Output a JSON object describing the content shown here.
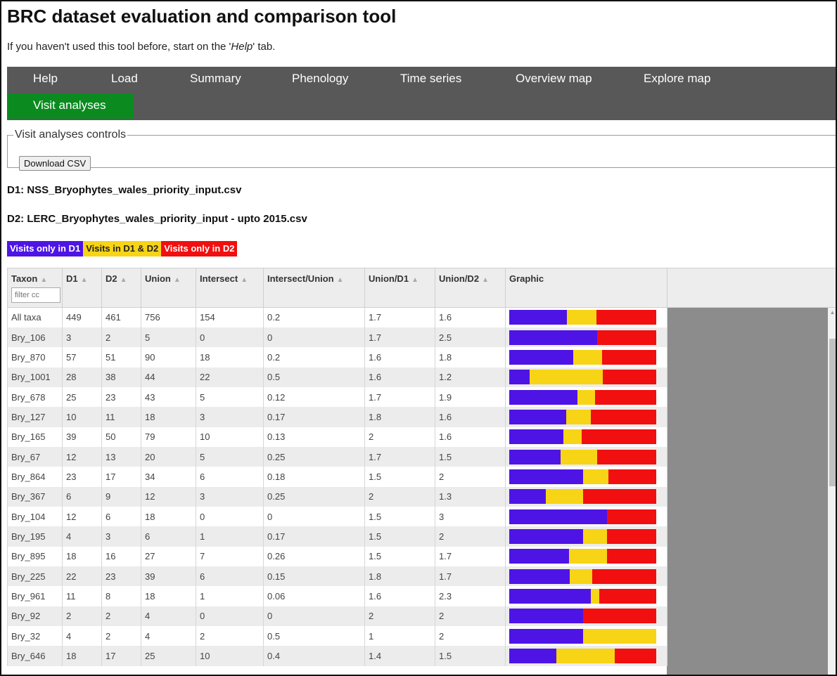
{
  "title": "BRC dataset evaluation and comparison tool",
  "intro": {
    "before": "If you haven't used this tool before, start on the '",
    "emph": "Help",
    "after": "' tab."
  },
  "nav": {
    "tabs": [
      "Help",
      "Load",
      "Summary",
      "Phenology",
      "Time series",
      "Overview map",
      "Explore map"
    ],
    "active_tab": "Visit analyses"
  },
  "controls": {
    "legend": "Visit analyses controls",
    "download_label": "Download CSV"
  },
  "datasets": {
    "d1": "D1: NSS_Bryophytes_wales_priority_input.csv",
    "d2": "D2: LERC_Bryophytes_wales_priority_input - upto 2015.csv"
  },
  "legend": {
    "only_d1": "Visits only in D1",
    "both": "Visits in D1 & D2",
    "only_d2": "Visits only in D2"
  },
  "colors": {
    "only_d1": "#4e14e6",
    "both": "#f7d415",
    "only_d2": "#f20f0f",
    "nav_bg": "#585858",
    "active_tab": "#0a8a1f"
  },
  "table": {
    "columns": [
      "Taxon",
      "D1",
      "D2",
      "Union",
      "Intersect",
      "Intersect/Union",
      "Union/D1",
      "Union/D2",
      "Graphic"
    ],
    "filter_placeholder": "filter cc",
    "rows": [
      [
        "All taxa",
        "449",
        "461",
        "756",
        "154",
        "0.2",
        "1.7",
        "1.6"
      ],
      [
        "Bry_106",
        "3",
        "2",
        "5",
        "0",
        "0",
        "1.7",
        "2.5"
      ],
      [
        "Bry_870",
        "57",
        "51",
        "90",
        "18",
        "0.2",
        "1.6",
        "1.8"
      ],
      [
        "Bry_1001",
        "28",
        "38",
        "44",
        "22",
        "0.5",
        "1.6",
        "1.2"
      ],
      [
        "Bry_678",
        "25",
        "23",
        "43",
        "5",
        "0.12",
        "1.7",
        "1.9"
      ],
      [
        "Bry_127",
        "10",
        "11",
        "18",
        "3",
        "0.17",
        "1.8",
        "1.6"
      ],
      [
        "Bry_165",
        "39",
        "50",
        "79",
        "10",
        "0.13",
        "2",
        "1.6"
      ],
      [
        "Bry_67",
        "12",
        "13",
        "20",
        "5",
        "0.25",
        "1.7",
        "1.5"
      ],
      [
        "Bry_864",
        "23",
        "17",
        "34",
        "6",
        "0.18",
        "1.5",
        "2"
      ],
      [
        "Bry_367",
        "6",
        "9",
        "12",
        "3",
        "0.25",
        "2",
        "1.3"
      ],
      [
        "Bry_104",
        "12",
        "6",
        "18",
        "0",
        "0",
        "1.5",
        "3"
      ],
      [
        "Bry_195",
        "4",
        "3",
        "6",
        "1",
        "0.17",
        "1.5",
        "2"
      ],
      [
        "Bry_895",
        "18",
        "16",
        "27",
        "7",
        "0.26",
        "1.5",
        "1.7"
      ],
      [
        "Bry_225",
        "22",
        "23",
        "39",
        "6",
        "0.15",
        "1.8",
        "1.7"
      ],
      [
        "Bry_961",
        "11",
        "8",
        "18",
        "1",
        "0.06",
        "1.6",
        "2.3"
      ],
      [
        "Bry_92",
        "2",
        "2",
        "4",
        "0",
        "0",
        "2",
        "2"
      ],
      [
        "Bry_32",
        "4",
        "2",
        "4",
        "2",
        "0.5",
        "1",
        "2"
      ],
      [
        "Bry_646",
        "18",
        "17",
        "25",
        "10",
        "0.4",
        "1.4",
        "1.5"
      ]
    ]
  }
}
